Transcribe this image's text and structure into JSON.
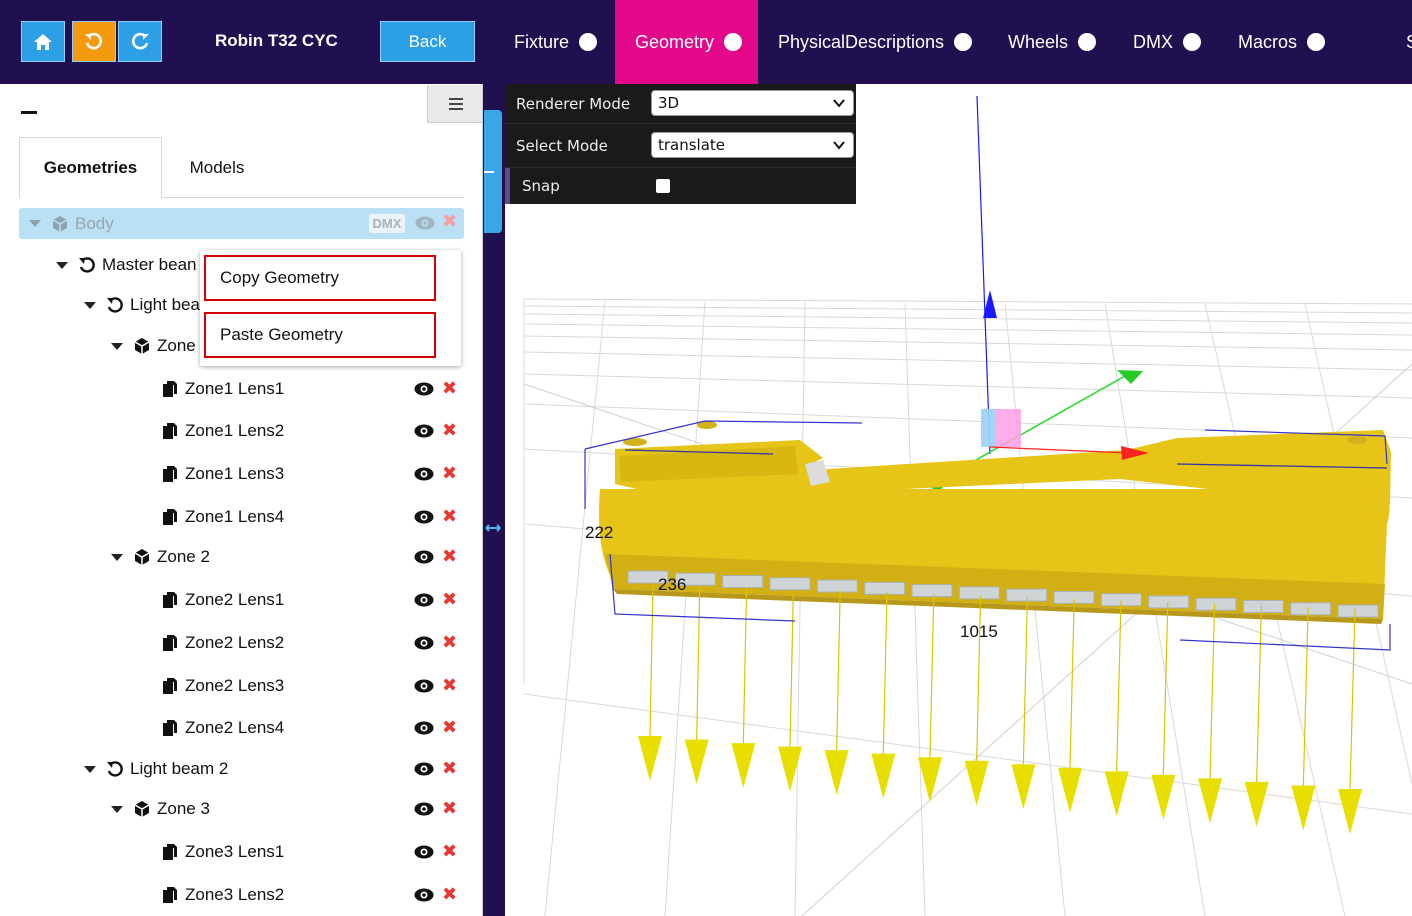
{
  "topbar": {
    "title": "Robin T32 CYC",
    "back_label": "Back",
    "tabs": [
      {
        "label": "Fixture",
        "active": false
      },
      {
        "label": "Geometry",
        "active": true
      },
      {
        "label": "PhysicalDescriptions",
        "active": false
      },
      {
        "label": "Wheels",
        "active": false
      },
      {
        "label": "DMX",
        "active": false
      },
      {
        "label": "Macros",
        "active": false
      },
      {
        "label": "S",
        "active": false
      }
    ],
    "colors": {
      "bar": "#211050",
      "active_tab": "#e3078a",
      "button_blue": "#2c9fe6",
      "button_orange": "#f39a0e"
    }
  },
  "panel": {
    "tabs": [
      {
        "label": "Geometries"
      },
      {
        "label": "Models"
      }
    ],
    "tree": {
      "root": {
        "label": "Body",
        "badge": "DMX"
      },
      "items": [
        {
          "label": "Master bean",
          "icon": "reset-icon",
          "caret": true
        },
        {
          "label": "Light bea",
          "icon": "reset-icon",
          "caret": true
        },
        {
          "label": "Zone",
          "icon": "cube-icon",
          "caret": true
        },
        {
          "label": "Zone1 Lens1",
          "icon": "file-copy-icon",
          "caret": false
        },
        {
          "label": "Zone1 Lens2",
          "icon": "file-copy-icon",
          "caret": false
        },
        {
          "label": "Zone1 Lens3",
          "icon": "file-copy-icon",
          "caret": false
        },
        {
          "label": "Zone1 Lens4",
          "icon": "file-copy-icon",
          "caret": false
        },
        {
          "label": "Zone 2",
          "icon": "cube-icon",
          "caret": true
        },
        {
          "label": "Zone2 Lens1",
          "icon": "file-copy-icon",
          "caret": false
        },
        {
          "label": "Zone2 Lens2",
          "icon": "file-copy-icon",
          "caret": false
        },
        {
          "label": "Zone2 Lens3",
          "icon": "file-copy-icon",
          "caret": false
        },
        {
          "label": "Zone2 Lens4",
          "icon": "file-copy-icon",
          "caret": false
        },
        {
          "label": "Light beam 2",
          "icon": "reset-icon",
          "caret": true
        },
        {
          "label": "Zone 3",
          "icon": "cube-icon",
          "caret": true
        },
        {
          "label": "Zone3 Lens1",
          "icon": "file-copy-icon",
          "caret": false
        },
        {
          "label": "Zone3 Lens2",
          "icon": "file-copy-icon",
          "caret": false
        }
      ]
    },
    "context_menu": {
      "copy_label": "Copy Geometry",
      "paste_label": "Paste Geometry"
    }
  },
  "settings": {
    "renderer_mode_label": "Renderer Mode",
    "renderer_mode_value": "3D",
    "select_mode_label": "Select Mode",
    "select_mode_value": "translate",
    "snap_label": "Snap",
    "snap_checked": false
  },
  "viewport": {
    "dimensions": {
      "depth": "222",
      "height": "236",
      "width": "1015"
    }
  }
}
